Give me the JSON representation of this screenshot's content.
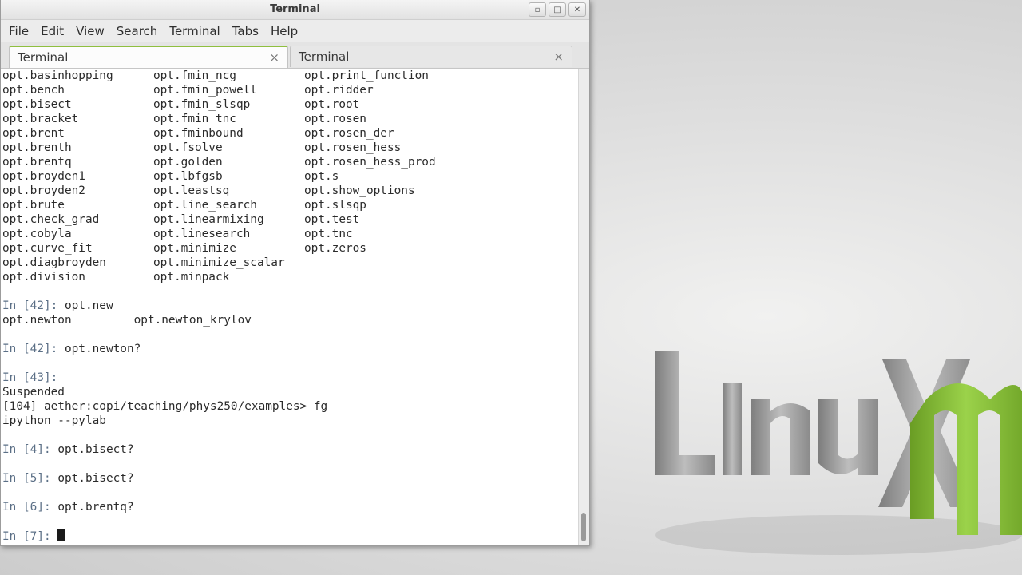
{
  "window": {
    "title": "Terminal",
    "controls": {
      "minimize": "▫",
      "maximize": "□",
      "close": "✕"
    }
  },
  "menu": [
    "File",
    "Edit",
    "View",
    "Search",
    "Terminal",
    "Tabs",
    "Help"
  ],
  "tabs": [
    {
      "label": "Terminal",
      "close": "×",
      "active": true
    },
    {
      "label": "Terminal",
      "close": "×",
      "active": false
    }
  ],
  "completion_columns": [
    [
      "opt.basinhopping",
      "opt.bench",
      "opt.bisect",
      "opt.bracket",
      "opt.brent",
      "opt.brenth",
      "opt.brentq",
      "opt.broyden1",
      "opt.broyden2",
      "opt.brute",
      "opt.check_grad",
      "opt.cobyla",
      "opt.curve_fit",
      "opt.diagbroyden",
      "opt.division"
    ],
    [
      "opt.fmin_ncg",
      "opt.fmin_powell",
      "opt.fmin_slsqp",
      "opt.fmin_tnc",
      "opt.fminbound",
      "opt.fsolve",
      "opt.golden",
      "opt.lbfgsb",
      "opt.leastsq",
      "opt.line_search",
      "opt.linearmixing",
      "opt.linesearch",
      "opt.minimize",
      "opt.minimize_scalar",
      "opt.minpack"
    ],
    [
      "opt.print_function",
      "opt.ridder",
      "opt.root",
      "opt.rosen",
      "opt.rosen_der",
      "opt.rosen_hess",
      "opt.rosen_hess_prod",
      "opt.s",
      "opt.show_options",
      "opt.slsqp",
      "opt.test",
      "opt.tnc",
      "opt.zeros",
      "",
      ""
    ]
  ],
  "session": [
    {
      "kind": "blank"
    },
    {
      "kind": "prompt",
      "prompt": "In [42]: ",
      "text": "opt.new"
    },
    {
      "kind": "text",
      "text": "opt.newton         opt.newton_krylov"
    },
    {
      "kind": "blank"
    },
    {
      "kind": "prompt",
      "prompt": "In [42]: ",
      "text": "opt.newton?"
    },
    {
      "kind": "blank"
    },
    {
      "kind": "prompt",
      "prompt": "In [43]: ",
      "text": ""
    },
    {
      "kind": "text",
      "text": "Suspended"
    },
    {
      "kind": "text",
      "text": "[104] aether:copi/teaching/phys250/examples> fg"
    },
    {
      "kind": "text",
      "text": "ipython --pylab"
    },
    {
      "kind": "blank"
    },
    {
      "kind": "prompt",
      "prompt": "In [4]: ",
      "text": "opt.bisect?"
    },
    {
      "kind": "blank"
    },
    {
      "kind": "prompt",
      "prompt": "In [5]: ",
      "text": "opt.bisect?"
    },
    {
      "kind": "blank"
    },
    {
      "kind": "prompt",
      "prompt": "In [6]: ",
      "text": "opt.brentq?"
    },
    {
      "kind": "blank"
    },
    {
      "kind": "prompt",
      "prompt": "In [7]: ",
      "text": "",
      "cursor": true
    }
  ],
  "desktop": {
    "logo_text": "LinuxMint"
  },
  "colors": {
    "prompt": "#5b6f86",
    "tab_accent": "#8fbf3f",
    "mint_green": "#8cc63f"
  }
}
